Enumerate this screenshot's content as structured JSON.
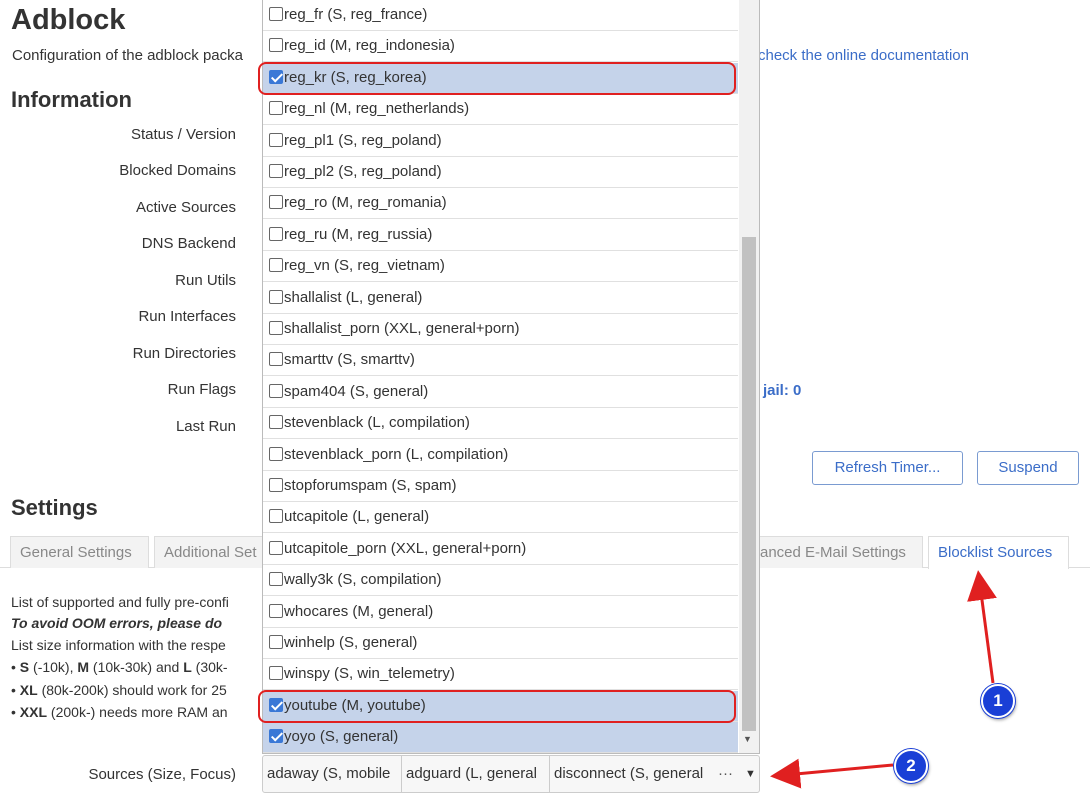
{
  "page": {
    "title": "Adblock",
    "subtitle": "Configuration of the adblock packa",
    "doc_link": "check the online documentation"
  },
  "information": {
    "heading": "Information",
    "labels": [
      "Status / Version",
      "Blocked Domains",
      "Active Sources",
      "DNS Backend",
      "Run Utils",
      "Run Interfaces",
      "Run Directories",
      "Run Flags",
      "Last Run"
    ],
    "jail": "jail: 0"
  },
  "buttons": {
    "refresh": "Refresh Timer...",
    "suspend": "Suspend"
  },
  "settings": {
    "heading": "Settings",
    "tabs": [
      "General Settings",
      "Additional Set",
      "anced E-Mail Settings",
      "Blocklist Sources"
    ],
    "active_tab": "Blocklist Sources"
  },
  "blocklist_text": {
    "line1": "List of supported and fully pre-confi",
    "line2": "To avoid OOM errors, please do",
    "line3": "List size information with the respe",
    "line4_s": "S",
    "line4_a": " (-10k), ",
    "line4_m": "M",
    "line4_b": " (10k-30k) and ",
    "line4_l": "L",
    "line4_c": " (30k-",
    "line5_xl": "XL",
    "line5_a": " (80k-200k) should work for 25",
    "line6_xxl": "XXL",
    "line6_a": " (200k-) needs more RAM an",
    "bullet": "•"
  },
  "sources": {
    "label": "Sources (Size, Focus)",
    "chips": [
      "adaway (S, mobile",
      "adguard (L, general",
      "disconnect (S, general"
    ],
    "more": "···",
    "arrow": "▼"
  },
  "dropdown": {
    "items": [
      {
        "label": "reg_fr (S, reg_france)",
        "checked": false
      },
      {
        "label": "reg_id (M, reg_indonesia)",
        "checked": false
      },
      {
        "label": "reg_kr (S, reg_korea)",
        "checked": true
      },
      {
        "label": "reg_nl (M, reg_netherlands)",
        "checked": false
      },
      {
        "label": "reg_pl1 (S, reg_poland)",
        "checked": false
      },
      {
        "label": "reg_pl2 (S, reg_poland)",
        "checked": false
      },
      {
        "label": "reg_ro (M, reg_romania)",
        "checked": false
      },
      {
        "label": "reg_ru (M, reg_russia)",
        "checked": false
      },
      {
        "label": "reg_vn (S, reg_vietnam)",
        "checked": false
      },
      {
        "label": "shallalist (L, general)",
        "checked": false
      },
      {
        "label": "shallalist_porn (XXL, general+porn)",
        "checked": false
      },
      {
        "label": "smarttv (S, smarttv)",
        "checked": false
      },
      {
        "label": "spam404 (S, general)",
        "checked": false
      },
      {
        "label": "stevenblack (L, compilation)",
        "checked": false
      },
      {
        "label": "stevenblack_porn (L, compilation)",
        "checked": false
      },
      {
        "label": "stopforumspam (S, spam)",
        "checked": false
      },
      {
        "label": "utcapitole (L, general)",
        "checked": false
      },
      {
        "label": "utcapitole_porn (XXL, general+porn)",
        "checked": false
      },
      {
        "label": "wally3k (S, compilation)",
        "checked": false
      },
      {
        "label": "whocares (M, general)",
        "checked": false
      },
      {
        "label": "winhelp (S, general)",
        "checked": false
      },
      {
        "label": "winspy (S, win_telemetry)",
        "checked": false
      },
      {
        "label": "youtube (M, youtube)",
        "checked": true
      },
      {
        "label": "yoyo (S, general)",
        "checked": true
      }
    ],
    "scroll_arrow": "▼"
  },
  "annotations": {
    "badge1": "1",
    "badge2": "2"
  },
  "colors": {
    "accent": "#3b6dc8",
    "selected_row": "#c5d3ea",
    "highlight": "#e02020",
    "badge": "#1a3fd6"
  }
}
